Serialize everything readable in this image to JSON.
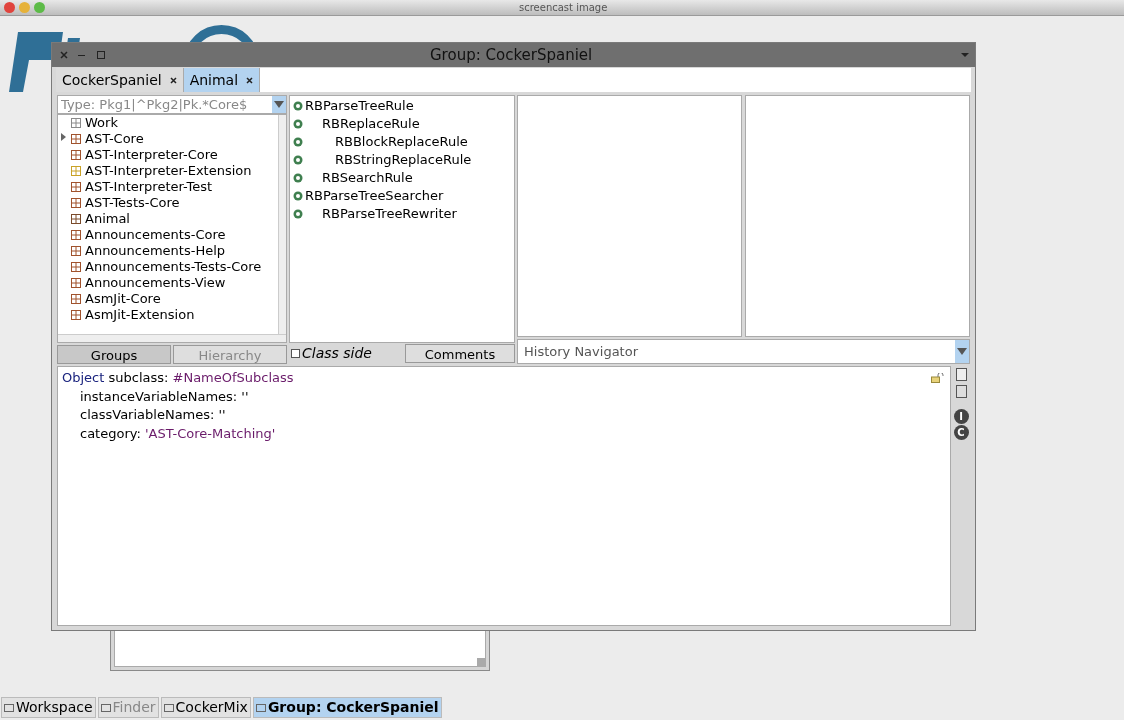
{
  "screen_title": "screencast image",
  "window": {
    "title": "Group: CockerSpaniel",
    "tabs": [
      {
        "label": "CockerSpaniel",
        "selected": false
      },
      {
        "label": "Animal",
        "selected": true
      }
    ],
    "package_filter": {
      "placeholder": "Type: Pkg1|^Pkg2|Pk.*Core$"
    },
    "packages": [
      {
        "name": "Work",
        "kind": "group",
        "expandable": false
      },
      {
        "name": "AST-Core",
        "kind": "package",
        "expandable": true
      },
      {
        "name": "AST-Interpreter-Core",
        "kind": "package",
        "expandable": false
      },
      {
        "name": "AST-Interpreter-Extension",
        "kind": "extension",
        "expandable": false
      },
      {
        "name": "AST-Interpreter-Test",
        "kind": "package",
        "expandable": false
      },
      {
        "name": "AST-Tests-Core",
        "kind": "package",
        "expandable": false
      },
      {
        "name": "Animal",
        "kind": "mixed",
        "expandable": false
      },
      {
        "name": "Announcements-Core",
        "kind": "package",
        "expandable": false
      },
      {
        "name": "Announcements-Help",
        "kind": "package",
        "expandable": false
      },
      {
        "name": "Announcements-Tests-Core",
        "kind": "package",
        "expandable": false
      },
      {
        "name": "Announcements-View",
        "kind": "package",
        "expandable": false
      },
      {
        "name": "AsmJit-Core",
        "kind": "package",
        "expandable": false
      },
      {
        "name": "AsmJit-Extension",
        "kind": "package",
        "expandable": false
      }
    ],
    "package_buttons": [
      {
        "label": "Groups",
        "selected": true,
        "disabled": false
      },
      {
        "label": "Hierarchy",
        "selected": false,
        "disabled": true
      }
    ],
    "classes": [
      {
        "name": "RBParseTreeRule",
        "children": [
          {
            "name": "RBReplaceRule",
            "children": [
              {
                "name": "RBBlockReplaceRule"
              },
              {
                "name": "RBStringReplaceRule"
              }
            ]
          },
          {
            "name": "RBSearchRule"
          }
        ]
      },
      {
        "name": "RBParseTreeSearcher",
        "children": [
          {
            "name": "RBParseTreeRewriter"
          }
        ]
      }
    ],
    "class_side": {
      "label": "Class side",
      "checked": false
    },
    "comments_button": "Comments",
    "history": {
      "placeholder": "History Navigator"
    },
    "code": [
      [
        {
          "text": "Object",
          "kind": "class"
        },
        {
          "text": " subclass: ",
          "kind": "plain"
        },
        {
          "text": "#NameOfSubclass",
          "kind": "symbol"
        }
      ],
      [
        {
          "text": "instanceVariableNames: ''",
          "kind": "plain"
        }
      ],
      [
        {
          "text": "classVariableNames: ''",
          "kind": "plain"
        }
      ],
      [
        {
          "text": "category: ",
          "kind": "plain"
        },
        {
          "text": "'AST-Core-Matching'",
          "kind": "string"
        }
      ]
    ],
    "side_buttons": [
      {
        "label": "I"
      },
      {
        "label": "C"
      }
    ]
  },
  "taskbar": [
    {
      "label": "Workspace",
      "selected": false,
      "disabled": false
    },
    {
      "label": "Finder",
      "selected": false,
      "disabled": true
    },
    {
      "label": "CockerMix",
      "selected": false,
      "disabled": false
    },
    {
      "label": "Group: CockerSpaniel",
      "selected": true,
      "disabled": false
    }
  ]
}
